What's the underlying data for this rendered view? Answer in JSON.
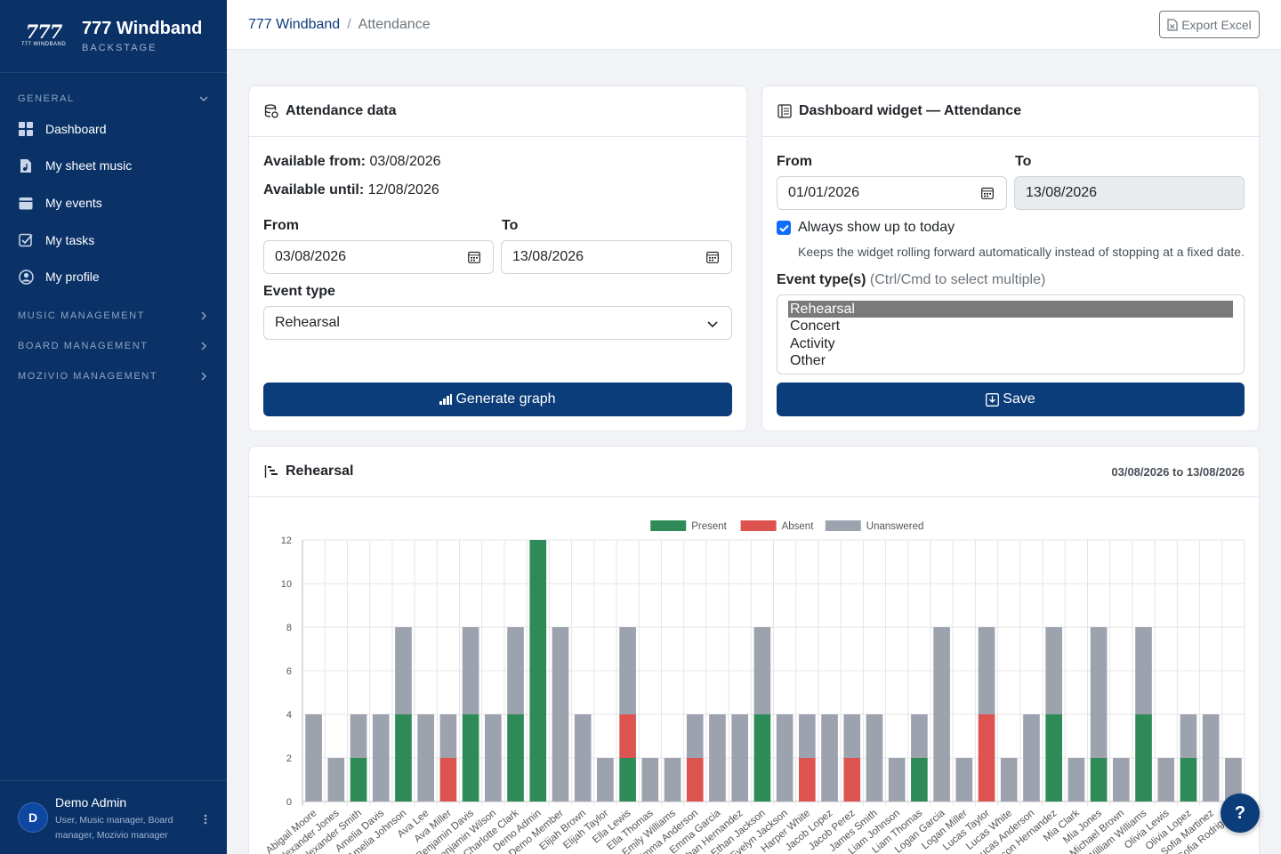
{
  "brand": {
    "logo_text": "777",
    "logo_sub": "777 WINDBAND",
    "name": "777 Windband",
    "tagline": "BACKSTAGE"
  },
  "sidebar": {
    "general_label": "GENERAL",
    "items": [
      {
        "label": "Dashboard",
        "icon": "grid-icon"
      },
      {
        "label": "My sheet music",
        "icon": "sheet-music-icon"
      },
      {
        "label": "My events",
        "icon": "calendar-icon"
      },
      {
        "label": "My tasks",
        "icon": "check-square-icon"
      },
      {
        "label": "My profile",
        "icon": "user-circle-icon"
      }
    ],
    "sections": [
      "MUSIC MANAGEMENT",
      "BOARD MANAGEMENT",
      "MOZIVIO MANAGEMENT"
    ]
  },
  "user": {
    "initial": "D",
    "name": "Demo Admin",
    "roles": "User, Music manager, Board manager, Mozivio manager"
  },
  "breadcrumb": {
    "parent": "777 Windband",
    "current": "Attendance"
  },
  "toolbar": {
    "export_label": "Export Excel"
  },
  "attendance_card": {
    "title": "Attendance data",
    "available_from_label": "Available from:",
    "available_from": "03/08/2026",
    "available_until_label": "Available until:",
    "available_until": "12/08/2026",
    "from_label": "From",
    "from_value": "03/08/2026",
    "to_label": "To",
    "to_value": "13/08/2026",
    "event_type_label": "Event type",
    "event_type_value": "Rehearsal",
    "generate_label": "Generate graph"
  },
  "widget_card": {
    "title": "Dashboard widget — Attendance",
    "from_label": "From",
    "from_value": "01/01/2026",
    "to_label": "To",
    "to_value": "13/08/2026",
    "always_label": "Always show up to today",
    "always_help": "Keeps the widget rolling forward automatically instead of stopping at a fixed date.",
    "event_types_label": "Event type(s)",
    "event_types_hint": "(Ctrl/Cmd to select multiple)",
    "options": [
      "Rehearsal",
      "Concert",
      "Activity",
      "Other"
    ],
    "save_label": "Save"
  },
  "chart_card": {
    "title": "Rehearsal",
    "range": "03/08/2026 to 13/08/2026"
  },
  "chart_data": {
    "type": "bar",
    "stacked": true,
    "ylim": [
      0,
      12
    ],
    "yticks": [
      0,
      2,
      4,
      6,
      8,
      10,
      12
    ],
    "legend_position": "top",
    "grid": true,
    "categories": [
      "Abigail Moore",
      "Alexander Jones",
      "Alexander Smith",
      "Amelia Davis",
      "Amelia Johnson",
      "Ava Lee",
      "Ava Miller",
      "Benjamin Davis",
      "Benjamin Wilson",
      "Charlotte Clark",
      "Demo Admin",
      "Demo Member",
      "Elijah Brown",
      "Elijah Taylor",
      "Ella Lewis",
      "Ella Thomas",
      "Emily Williams",
      "Emma Anderson",
      "Emma Garcia",
      "Ethan Hernandez",
      "Ethan Jackson",
      "Evelyn Jackson",
      "Harper White",
      "Jacob Lopez",
      "Jacob Perez",
      "James Smith",
      "Liam Johnson",
      "Liam Thomas",
      "Logan Garcia",
      "Logan Miller",
      "Lucas Taylor",
      "Lucas White",
      "Lucas Anderson",
      "Mason Hernandez",
      "Mia Clark",
      "Mia Jones",
      "Michael Brown",
      "William Williams",
      "Olivia Lewis",
      "Olivia Lopez",
      "Sofia Martinez",
      "Sofia Rodriguez"
    ],
    "series": [
      {
        "name": "Present",
        "color": "#2e8b57",
        "values": [
          0,
          0,
          2,
          0,
          4,
          0,
          0,
          4,
          0,
          4,
          12,
          0,
          0,
          0,
          2,
          0,
          0,
          0,
          0,
          0,
          4,
          0,
          0,
          0,
          0,
          0,
          0,
          2,
          0,
          0,
          0,
          0,
          0,
          4,
          0,
          2,
          0,
          4,
          0,
          2,
          0,
          0
        ]
      },
      {
        "name": "Absent",
        "color": "#dc5350",
        "values": [
          0,
          0,
          0,
          0,
          0,
          0,
          2,
          0,
          0,
          0,
          0,
          0,
          0,
          0,
          2,
          0,
          0,
          2,
          0,
          0,
          0,
          0,
          2,
          0,
          2,
          0,
          0,
          0,
          0,
          0,
          4,
          0,
          0,
          0,
          0,
          0,
          0,
          0,
          0,
          0,
          0,
          0
        ]
      },
      {
        "name": "Unanswered",
        "color": "#9ca3af",
        "values": [
          4,
          2,
          2,
          4,
          4,
          4,
          2,
          4,
          4,
          4,
          0,
          8,
          4,
          2,
          4,
          2,
          2,
          2,
          4,
          4,
          4,
          4,
          2,
          4,
          2,
          4,
          2,
          2,
          8,
          2,
          4,
          2,
          4,
          4,
          2,
          6,
          2,
          4,
          2,
          2,
          4,
          2
        ]
      }
    ]
  },
  "help_label": "?"
}
